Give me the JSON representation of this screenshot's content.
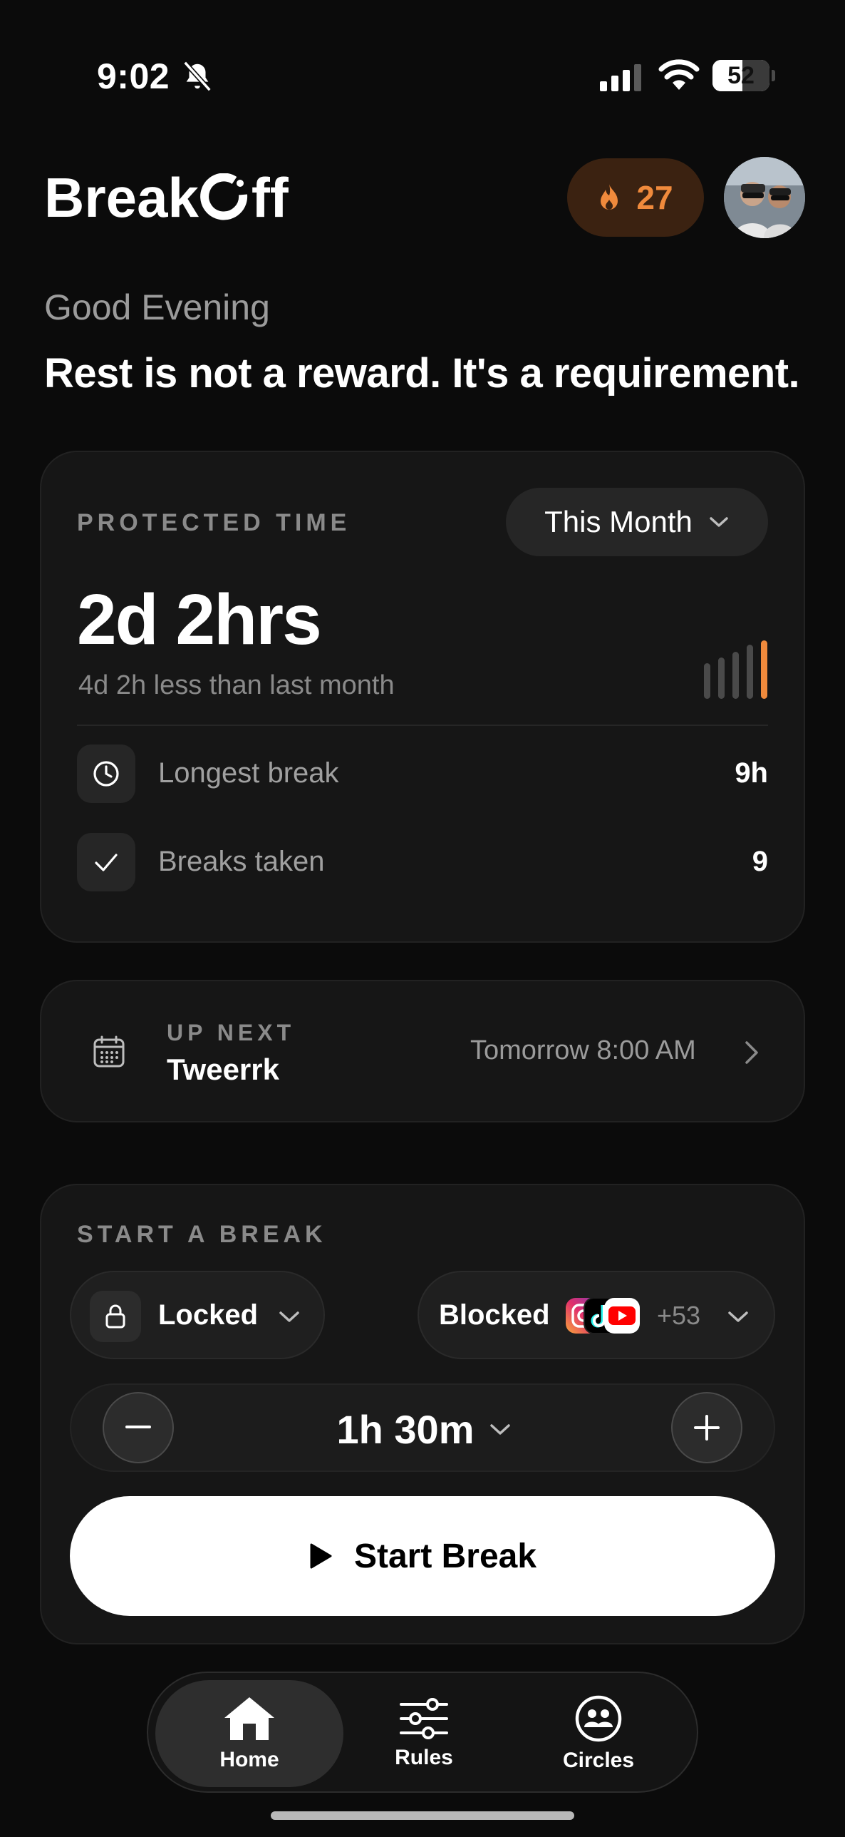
{
  "status_bar": {
    "time": "9:02",
    "battery": "52",
    "battery_level": 0.52
  },
  "header": {
    "logo": "BreakOff",
    "logo_prefix": "Break",
    "logo_suffix": "ff",
    "streak_count": "27",
    "accent_color": "#f08a3c"
  },
  "greeting": "Good Evening",
  "tagline": "Rest is not a reward. It's a requirement.",
  "protected_time": {
    "eyebrow": "PROTECTED TIME",
    "period": "This Month",
    "value": "2d 2hrs",
    "comparison": "4d 2h less than last month",
    "stats": [
      {
        "label": "Longest break",
        "value": "9h",
        "icon": "clock-icon"
      },
      {
        "label": "Breaks taken",
        "value": "9",
        "icon": "check-icon"
      }
    ]
  },
  "up_next": {
    "eyebrow": "UP NEXT",
    "title": "Tweerrk",
    "time": "Tomorrow 8:00 AM"
  },
  "start_break": {
    "eyebrow": "START A BREAK",
    "mode": "Locked",
    "blocked_label": "Blocked",
    "blocked_apps": [
      "instagram-icon",
      "tiktok-icon",
      "youtube-icon"
    ],
    "blocked_more": "+53",
    "duration": "1h 30m",
    "button": "Start Break"
  },
  "tabs": [
    {
      "label": "Home",
      "icon": "home-icon",
      "active": true
    },
    {
      "label": "Rules",
      "icon": "sliders-icon",
      "active": false
    },
    {
      "label": "Circles",
      "icon": "people-icon",
      "active": false
    }
  ]
}
